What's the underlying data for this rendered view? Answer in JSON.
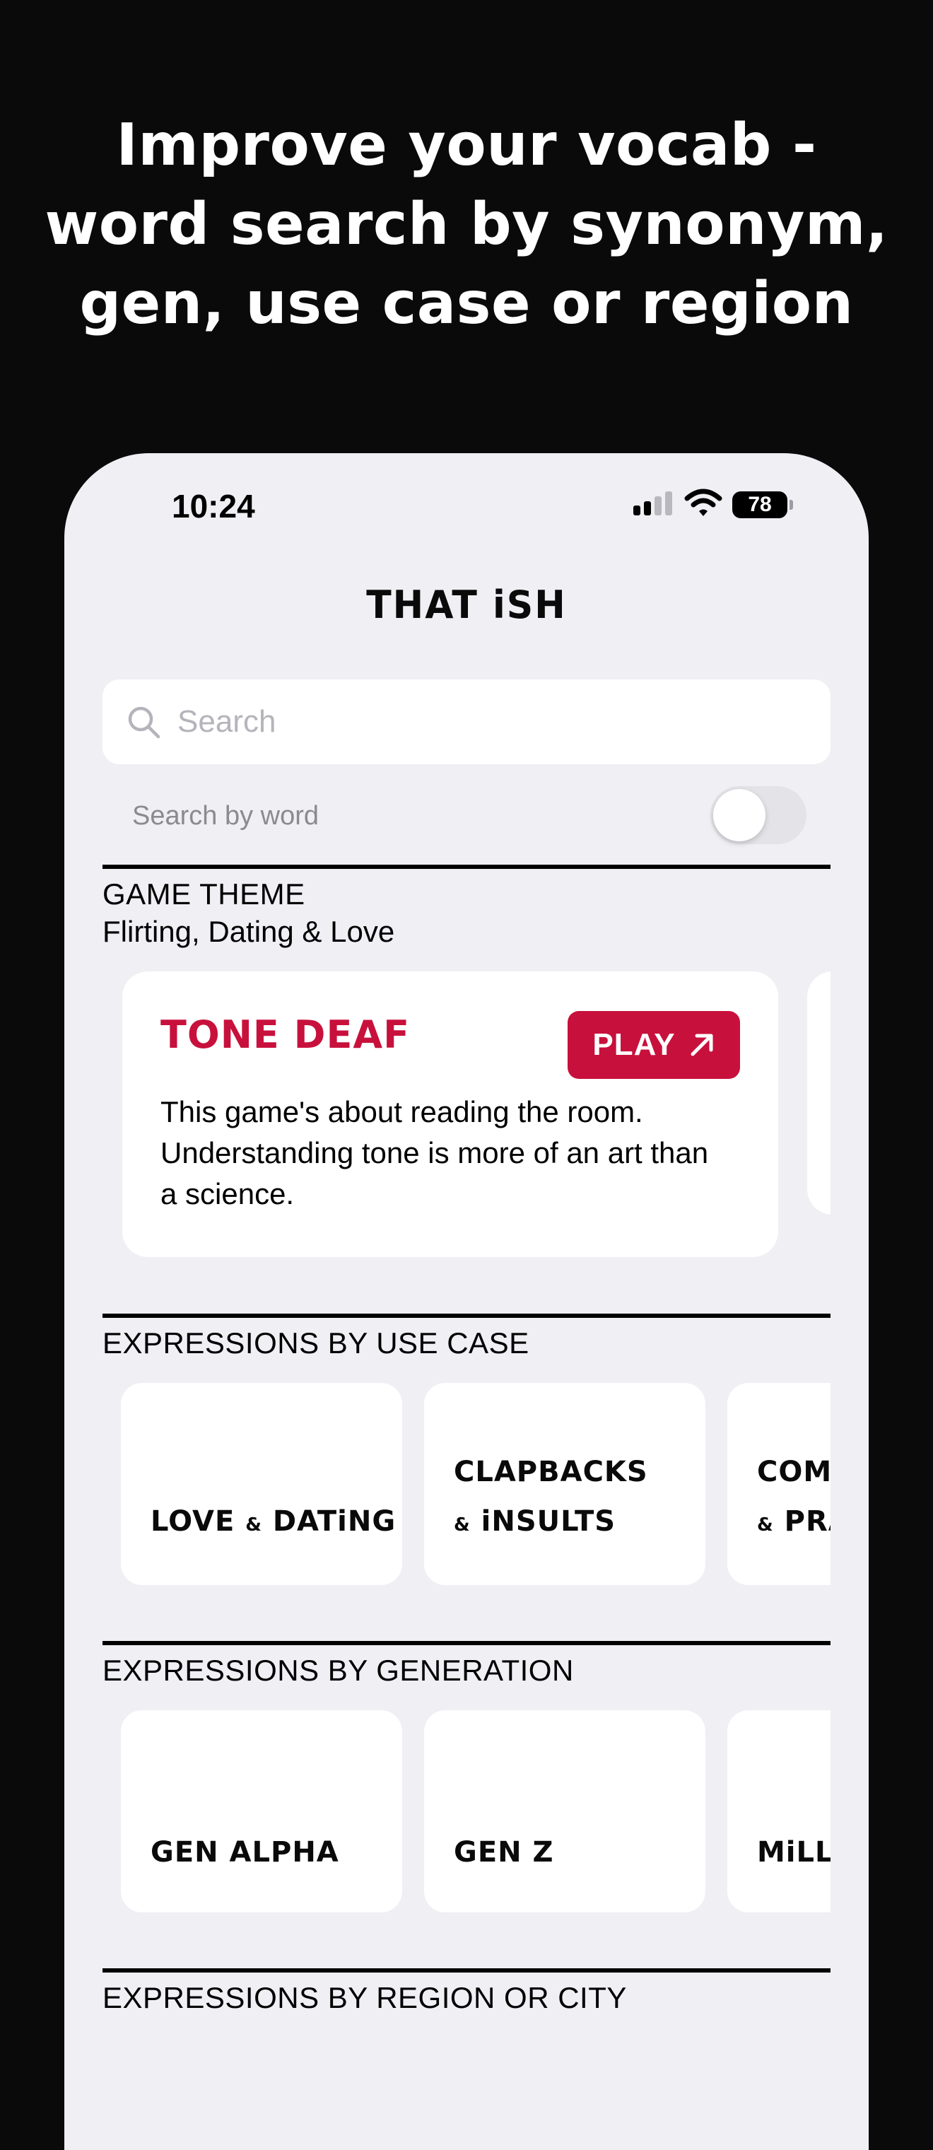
{
  "promo": {
    "line1": "Improve your vocab -",
    "line2": "word search by synonym,",
    "line3": "gen, use case or region"
  },
  "status_bar": {
    "time": "10:24",
    "battery": "78"
  },
  "app": {
    "logo_text": "THAT iSH"
  },
  "search": {
    "placeholder": "Search",
    "value": ""
  },
  "toggle": {
    "label": "Search by word",
    "on": false
  },
  "game_theme": {
    "heading": "GAME THEME",
    "subheading": "Flirting, Dating & Love",
    "card": {
      "title": "TONE DEAF",
      "play_label": "PLAY",
      "description": "This game's about reading the room. Understanding tone is more of an art than a science."
    }
  },
  "use_case": {
    "heading": "EXPRESSIONS BY USE CASE",
    "tiles": [
      {
        "line1": "",
        "line2_a": "LOVE",
        "line2_amp": "&",
        "line2_b": "DATiNG"
      },
      {
        "line1": "CLAPBACKS",
        "line2_a": "",
        "line2_amp": "&",
        "line2_b": "iNSULTS"
      },
      {
        "line1": "COMPL",
        "line2_a": "",
        "line2_amp": "&",
        "line2_b": "PRA"
      }
    ]
  },
  "generation": {
    "heading": "EXPRESSIONS BY GENERATION",
    "tiles": [
      "GEN ALPHA",
      "GEN Z",
      "MiLLE"
    ]
  },
  "region": {
    "heading": "EXPRESSIONS BY REGION OR CITY"
  },
  "colors": {
    "accent": "#c8103c",
    "background": "#0b0a0b",
    "screen": "#efeff4"
  }
}
